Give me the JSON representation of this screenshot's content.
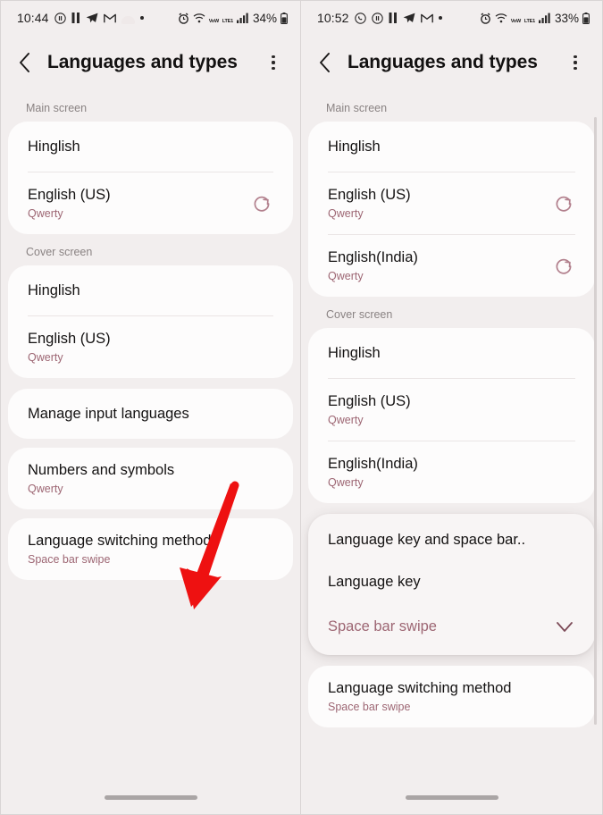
{
  "app": {
    "title": "Languages and types",
    "accent_color": "#9d6673",
    "background_color": "#f2eeee",
    "card_color": "#fdfcfc",
    "arrow_color": "#ee1111"
  },
  "left_screen": {
    "status_bar": {
      "time": "10:44",
      "left_icons": [
        "pause-circle-icon",
        "pause-icon",
        "telegram-icon",
        "gmail-icon",
        "cloud-icon",
        "dot-icon"
      ],
      "right_icons": [
        "alarm-icon",
        "wifi-icon",
        "volte-icon",
        "signal-icon"
      ],
      "volte_top": "VoW",
      "volte_bottom": "LTE1",
      "battery": "34%"
    },
    "header": {
      "back": "back-arrow",
      "title": "Languages and types",
      "menu": "more-options"
    },
    "sections": [
      {
        "label": "Main screen",
        "rows": [
          {
            "title": "Hinglish",
            "sub": "",
            "refresh": false
          },
          {
            "title": "English (US)",
            "sub": "Qwerty",
            "refresh": true
          }
        ]
      },
      {
        "label": "Cover screen",
        "rows": [
          {
            "title": "Hinglish",
            "sub": "",
            "refresh": false
          },
          {
            "title": "English (US)",
            "sub": "Qwerty",
            "refresh": false
          }
        ]
      }
    ],
    "standalone_rows": [
      {
        "title": "Manage input languages",
        "sub": ""
      },
      {
        "title": "Numbers and symbols",
        "sub": "Qwerty"
      },
      {
        "title": "Language switching method",
        "sub": "Space bar swipe"
      }
    ],
    "annotation": {
      "type": "red-arrow",
      "points_to": "Language switching method"
    }
  },
  "right_screen": {
    "status_bar": {
      "time": "10:52",
      "left_icons": [
        "whatsapp-icon",
        "pause-circle-icon",
        "pause-icon",
        "telegram-icon",
        "gmail-icon",
        "dot-icon"
      ],
      "right_icons": [
        "alarm-icon",
        "wifi-icon",
        "volte-icon",
        "signal-icon"
      ],
      "volte_top": "VoW",
      "volte_bottom": "LTE1",
      "battery": "33%"
    },
    "header": {
      "back": "back-arrow",
      "title": "Languages and types",
      "menu": "more-options"
    },
    "sections": [
      {
        "label": "Main screen",
        "rows": [
          {
            "title": "Hinglish",
            "sub": "",
            "refresh": false
          },
          {
            "title": "English (US)",
            "sub": "Qwerty",
            "refresh": true
          },
          {
            "title": "English(India)",
            "sub": "Qwerty",
            "refresh": true
          }
        ]
      },
      {
        "label": "Cover screen",
        "rows": [
          {
            "title": "Hinglish",
            "sub": "",
            "refresh": false
          },
          {
            "title": "English (US)",
            "sub": "Qwerty",
            "refresh": false
          },
          {
            "title": "English(India)",
            "sub": "Qwerty",
            "refresh": false
          }
        ]
      }
    ],
    "dialog": {
      "name": "language-switching-method-dialog",
      "options": [
        {
          "label": "Language key and space bar..",
          "selected": false
        },
        {
          "label": "Language key",
          "selected": false
        },
        {
          "label": "Space bar swipe",
          "selected": true
        }
      ]
    },
    "standalone_rows": [
      {
        "title": "Language switching method",
        "sub": "Space bar swipe"
      }
    ]
  }
}
